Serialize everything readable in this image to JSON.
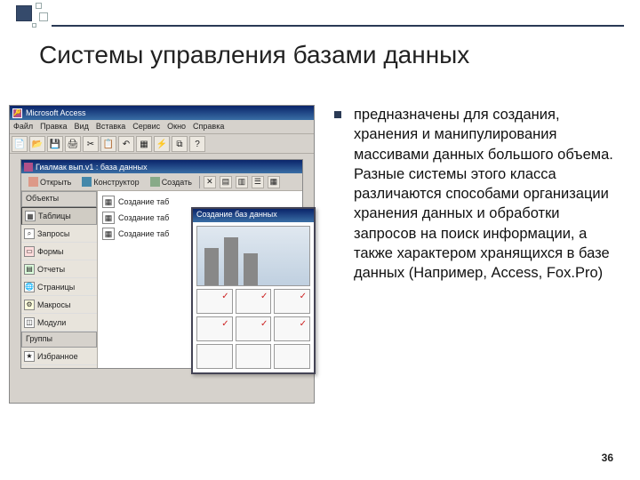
{
  "slide": {
    "title": "Системы управления базами данных",
    "body": "предназначены для создания, хранения и манипулирования массивами данных большого объема. Разные системы этого класса различаются способами организации хранения данных и обработки запросов на поиск информации, а также характером хранящихся в базе данных (Например, Access, Fox.Pro)",
    "page": "36"
  },
  "screenshot": {
    "appTitle": "Microsoft Access",
    "menu": [
      "Файл",
      "Правка",
      "Вид",
      "Вставка",
      "Сервис",
      "Окно",
      "Справка"
    ],
    "childTitle": "Гиалмак вып.v1 : база данных",
    "toolbar": {
      "open": "Открыть",
      "design": "Конструктор",
      "create": "Создать"
    },
    "sideHeader": "Объекты",
    "sideItems": [
      "Таблицы",
      "Запросы",
      "Формы",
      "Отчеты",
      "Страницы",
      "Макросы",
      "Модули"
    ],
    "sideGroups": "Группы",
    "sideFav": "Избранное",
    "listItems": [
      "Создание таб",
      "Создание таб",
      "Создание таб"
    ],
    "wizardTitle": "Создание баз данных"
  }
}
